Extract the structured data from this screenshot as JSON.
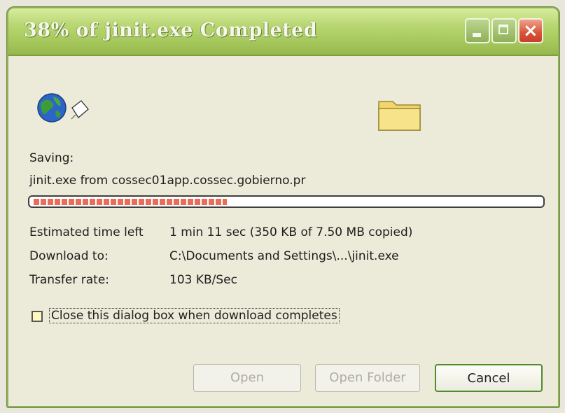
{
  "window": {
    "title": "38% of jinit.exe Completed"
  },
  "dialog": {
    "saving_label": "Saving:",
    "source": "jinit.exe from cossec01app.cossec.gobierno.pr",
    "progress_percent": 38,
    "estimated_label": "Estimated time left",
    "estimated_value": "1 min 11 sec (350 KB of 7.50 MB copied)",
    "download_to_label": "Download to:",
    "download_to_value": "C:\\Documents and Settings\\...\\jinit.exe",
    "transfer_rate_label": "Transfer rate:",
    "transfer_rate_value": "103 KB/Sec",
    "close_checkbox_label": "Close this dialog box when download completes",
    "close_checkbox_checked": false
  },
  "buttons": {
    "open": "Open",
    "open_folder": "Open Folder",
    "cancel": "Cancel"
  },
  "icons": {
    "globe": "globe-icon",
    "paper": "paper-icon",
    "folder": "folder-icon",
    "minimize": "minimize-icon",
    "maximize": "maximize-icon",
    "close": "close-icon"
  },
  "colors": {
    "titlebar": "#a6c85c",
    "progress": "#ea6d5a",
    "close_button": "#d8533a",
    "cancel_border": "#4f8b2e"
  }
}
